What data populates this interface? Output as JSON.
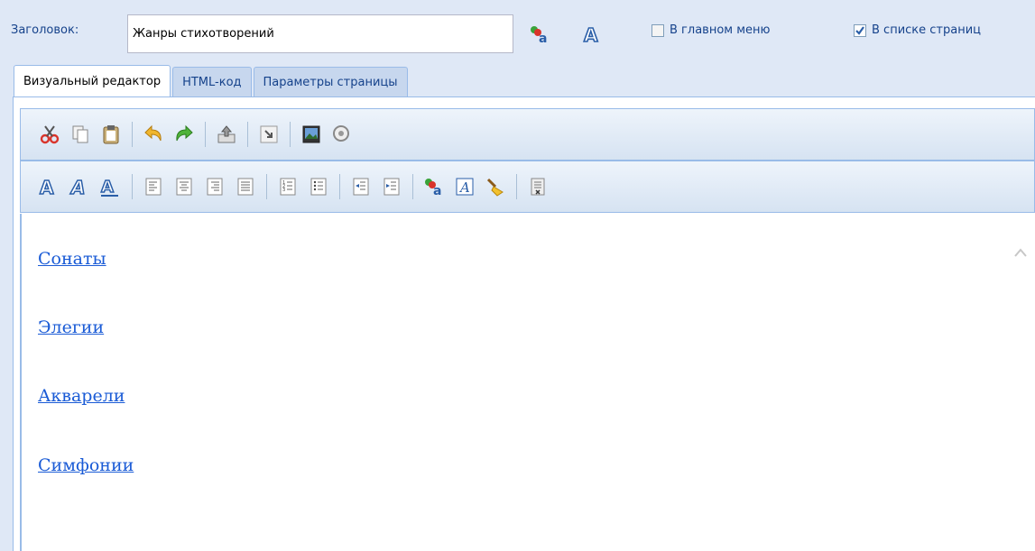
{
  "header": {
    "title_label": "Заголовок:",
    "title_value": "Жанры стихотворений",
    "in_main_menu": {
      "label": "В главном меню",
      "checked": false
    },
    "in_page_list": {
      "label": "В списке страниц",
      "checked": true
    }
  },
  "tabs": [
    {
      "label": "Визуальный редактор",
      "active": true
    },
    {
      "label": "HTML-код",
      "active": false
    },
    {
      "label": "Параметры страницы",
      "active": false
    }
  ],
  "toolbar1": [
    "cut-icon",
    "copy-icon",
    "paste-icon",
    "undo-icon",
    "redo-icon",
    "upload-icon",
    "insert-link-icon",
    "image-icon",
    "find-icon"
  ],
  "toolbar2": [
    "font-icon",
    "italic-font-icon",
    "underline-font-icon",
    "align-left-icon",
    "align-center-icon",
    "align-right-icon",
    "justify-icon",
    "ordered-list-icon",
    "unordered-list-icon",
    "outdent-icon",
    "indent-icon",
    "text-color-icon",
    "font-style-icon",
    "clear-format-icon",
    "source-icon"
  ],
  "content": {
    "links": [
      "Сонаты",
      "Элегии",
      "Акварели",
      "Симфонии"
    ]
  },
  "colors": {
    "link": "#1a5bd6",
    "panel_bg": "#dfe8f6",
    "border": "#99bbe8"
  }
}
